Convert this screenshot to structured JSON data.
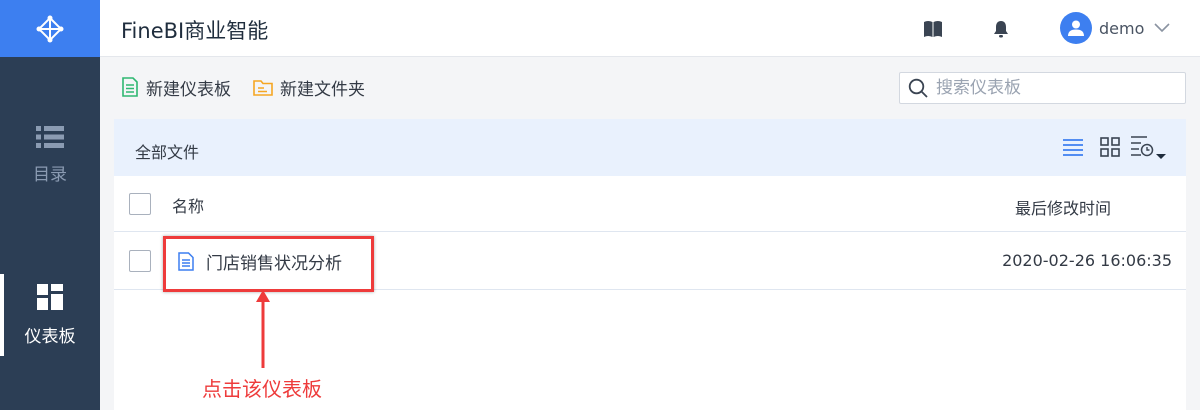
{
  "app": {
    "title": "FineBI商业智能"
  },
  "sidebar": {
    "items": [
      {
        "label": "目录",
        "icon": "list-icon",
        "active": false
      },
      {
        "label": "仪表板",
        "icon": "dashboard-icon",
        "active": true
      }
    ]
  },
  "header": {
    "user": {
      "name": "demo"
    }
  },
  "toolbar": {
    "new_dashboard_label": "新建仪表板",
    "new_folder_label": "新建文件夹",
    "search_placeholder": "搜索仪表板"
  },
  "main": {
    "breadcrumb": "全部文件",
    "columns": {
      "name": "名称",
      "modified": "最后修改时间"
    },
    "rows": [
      {
        "name": "门店销售状况分析",
        "modified": "2020-02-26 16:06:35",
        "icon": "dashboard-file-icon"
      }
    ]
  },
  "annotation": {
    "text": "点击该仪表板"
  },
  "colors": {
    "accent": "#3d7ff0",
    "sidebar_bg": "#2c3e55",
    "annotation": "#ee3b3b",
    "new_dashboard_icon": "#2eb872",
    "new_folder_icon": "#f5a623"
  }
}
